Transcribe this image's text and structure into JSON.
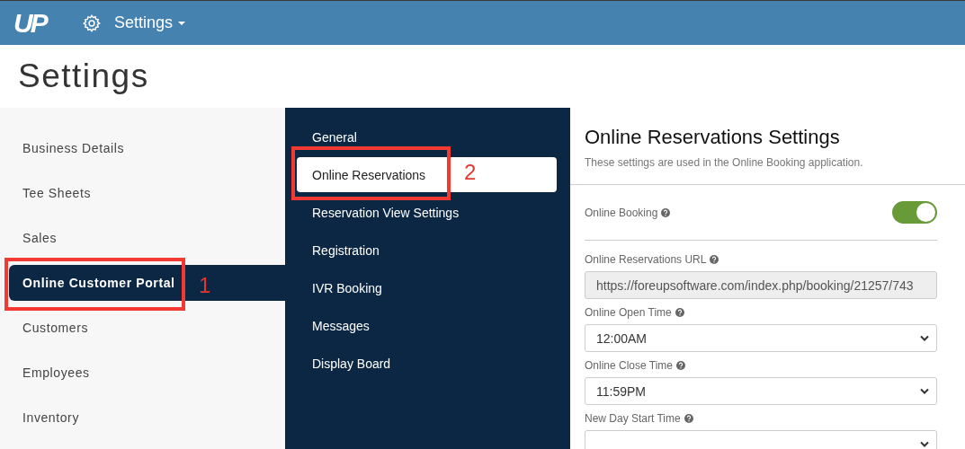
{
  "topbar": {
    "logo": "UP",
    "menu": "Settings"
  },
  "page_title": "Settings",
  "sidebar": {
    "items": [
      {
        "label": "Business Details",
        "selected": false
      },
      {
        "label": "Tee Sheets",
        "selected": false
      },
      {
        "label": "Sales",
        "selected": false
      },
      {
        "label": "Online Customer Portal",
        "selected": true
      },
      {
        "label": "Customers",
        "selected": false
      },
      {
        "label": "Employees",
        "selected": false
      },
      {
        "label": "Inventory",
        "selected": false
      }
    ]
  },
  "submenu": {
    "items": [
      {
        "label": "General",
        "selected": false
      },
      {
        "label": "Online Reservations",
        "selected": true
      },
      {
        "label": "Reservation View Settings",
        "selected": false
      },
      {
        "label": "Registration",
        "selected": false
      },
      {
        "label": "IVR Booking",
        "selected": false
      },
      {
        "label": "Messages",
        "selected": false
      },
      {
        "label": "Display Board",
        "selected": false
      }
    ]
  },
  "panel": {
    "title": "Online Reservations Settings",
    "subtitle": "These settings are used in the Online Booking application.",
    "fields": [
      {
        "kind": "toggle",
        "label": "Online Booking",
        "on": true
      },
      {
        "kind": "text",
        "label": "Online Reservations URL",
        "value": "https://foreupsoftware.com/index.php/booking/21257/743",
        "disabled": true
      },
      {
        "kind": "select",
        "label": "Online Open Time",
        "value": "12:00AM"
      },
      {
        "kind": "select",
        "label": "Online Close Time",
        "value": "11:59PM"
      },
      {
        "kind": "select",
        "label": "New Day Start Time"
      }
    ]
  },
  "annotations": [
    {
      "label": "1"
    },
    {
      "label": "2"
    }
  ]
}
